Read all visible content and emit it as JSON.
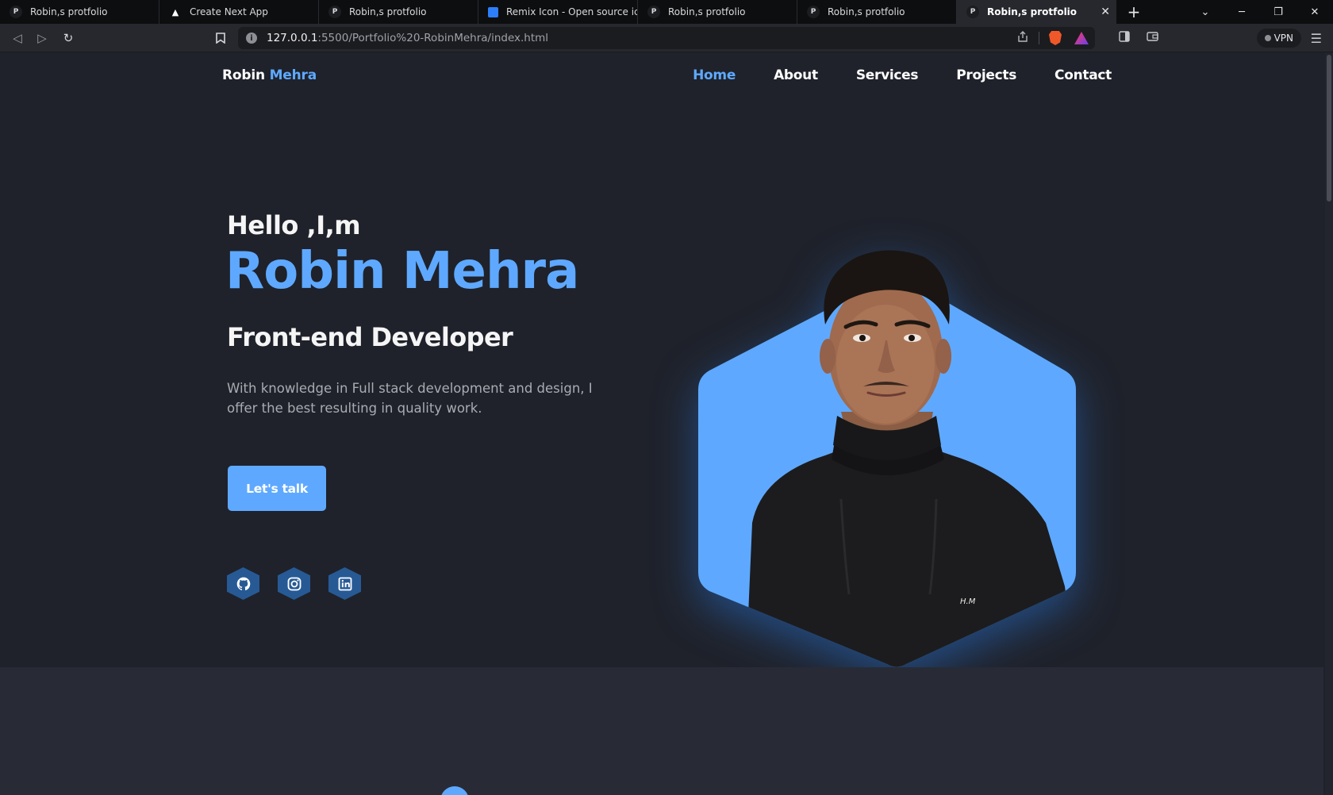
{
  "browser": {
    "tabs": [
      {
        "title": "Robin,s protfolio",
        "favicon": "P"
      },
      {
        "title": "Create Next App",
        "favicon": "vercel-triangle"
      },
      {
        "title": "Robin,s protfolio",
        "favicon": "P"
      },
      {
        "title": "Remix Icon - Open source icon",
        "favicon": "remix-icon"
      },
      {
        "title": "Robin,s protfolio",
        "favicon": "P"
      },
      {
        "title": "Robin,s protfolio",
        "favicon": "P"
      },
      {
        "title": "Robin,s protfolio",
        "favicon": "P",
        "active": true
      }
    ],
    "url_host": "127.0.0.1",
    "url_path": ":5500/Portfolio%20-RobinMehra/index.html",
    "vpn_label": "VPN"
  },
  "nav": {
    "logo_first": "Robin",
    "logo_accent": "Mehra",
    "links": [
      {
        "label": "Home",
        "active": true
      },
      {
        "label": "About"
      },
      {
        "label": "Services"
      },
      {
        "label": "Projects"
      },
      {
        "label": "Contact"
      }
    ]
  },
  "hero": {
    "greeting": "Hello ,I,m",
    "name": "Robin Mehra",
    "role": "Front-end Developer",
    "description": "With knowledge in Full stack development and design, I offer the best resulting in quality work.",
    "cta_label": "Let's talk",
    "socials": [
      "github-icon",
      "instagram-icon",
      "linkedin-icon"
    ]
  },
  "colors": {
    "accent": "#5ea9ff",
    "background": "#1f222b",
    "section_alt": "#282b36",
    "social_bg": "#275a95",
    "text_muted": "#a9abb2"
  }
}
